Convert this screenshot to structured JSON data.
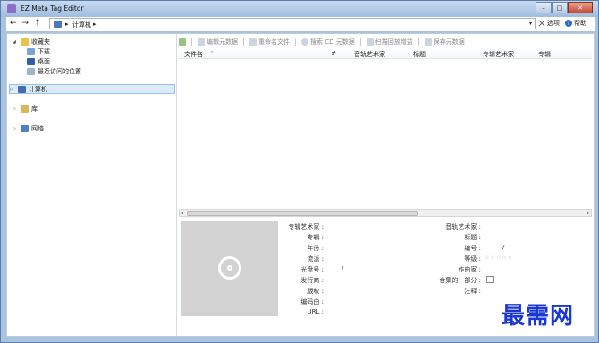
{
  "window": {
    "title": "EZ Meta Tag Editor"
  },
  "nav": {
    "back": "←",
    "forward": "→",
    "up": "↑",
    "address_segments": [
      "▸",
      "计算机",
      "▸"
    ],
    "options_label": "选项",
    "help_label": "帮助"
  },
  "tree": {
    "favorites": "收藏夹",
    "downloads": "下载",
    "desktop": "桌面",
    "recent": "最近访问的位置",
    "computer": "计算机",
    "libraries": "库",
    "network": "网络"
  },
  "toolbar": {
    "edit": "编辑元数据",
    "rename": "重命名文件",
    "search_cd": "搜索 CD 元数据",
    "scan_gain": "扫描回放增益",
    "save": "保存元数据"
  },
  "grid": {
    "columns": [
      "文件名",
      "#",
      "音轨艺术家",
      "标题",
      "专辑艺术家",
      "专辑"
    ]
  },
  "details": {
    "left_labels": [
      "专辑艺术家 :",
      "专辑 :",
      "年份 :",
      "流派 :",
      "光盘号 :",
      "发行商 :",
      "版权 :",
      "编码由 :",
      "URL :"
    ],
    "disc_sep": "/",
    "right_labels": [
      "音轨艺术家 :",
      "标题 :",
      "编号 :",
      "等级 :",
      "作曲家 :",
      "合集的一部分 :",
      "注释 :"
    ],
    "track_sep": "/",
    "rating": "☆☆☆☆☆"
  },
  "watermark": "最需网",
  "colors": {
    "accent": "#1a37d4",
    "selection": "#dceafa"
  }
}
